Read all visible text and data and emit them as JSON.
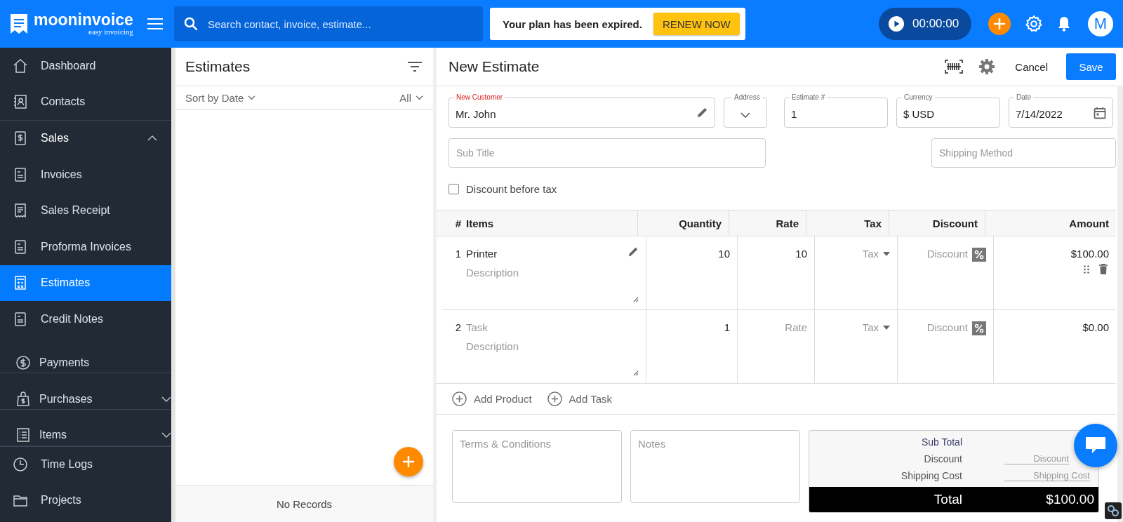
{
  "header": {
    "logo_name": "mooninvoice",
    "logo_tagline": "easy invoicing",
    "search": {
      "placeholder": "Search contact, invoice, estimate..."
    },
    "banner": {
      "message": "Your plan has been expired.",
      "button": "RENEW NOW"
    },
    "timer": "00:00:00",
    "avatar": "M"
  },
  "sidebar": {
    "items": [
      {
        "label": "Dashboard",
        "selected": false
      },
      {
        "label": "Contacts",
        "selected": false
      },
      {
        "label": "Sales",
        "selected": false,
        "expanded": true,
        "children": [
          {
            "label": "Invoices",
            "selected": false
          },
          {
            "label": "Sales Receipt",
            "selected": false
          },
          {
            "label": "Proforma Invoices",
            "selected": false
          },
          {
            "label": "Estimates",
            "selected": true
          },
          {
            "label": "Credit Notes",
            "selected": false
          },
          {
            "label": "Payments",
            "selected": false
          }
        ]
      },
      {
        "label": "Purchases",
        "selected": false,
        "expanded": false
      },
      {
        "label": "Items",
        "selected": false,
        "expanded": false
      },
      {
        "label": "Time Logs",
        "selected": false
      },
      {
        "label": "Projects",
        "selected": false
      }
    ]
  },
  "estimates_panel": {
    "title": "Estimates",
    "sort": "Sort by Date",
    "filter": "All",
    "empty_text": "No Records"
  },
  "editor": {
    "title": "New Estimate",
    "cancel": "Cancel",
    "save": "Save",
    "fields": [
      {
        "kind": "customer",
        "label": "New Customer",
        "value": "Mr. John",
        "required": true
      },
      {
        "kind": "select",
        "label": "Address",
        "required": false
      },
      {
        "kind": "text",
        "label": "Estimate #",
        "value": "1",
        "required": false
      },
      {
        "kind": "text",
        "label": "Currency",
        "value": "$ USD",
        "required": false
      },
      {
        "kind": "date",
        "label": "Date",
        "value": "7/14/2022",
        "required": false
      }
    ],
    "subtitle": {
      "placeholder": "Sub Title"
    },
    "shipping_method": {
      "placeholder": "Shipping Method"
    },
    "discount_before_tax": {
      "label": "Discount before tax",
      "checked": false
    },
    "table": {
      "columns": [
        "#",
        "Items",
        "Quantity",
        "Rate",
        "Tax",
        "Discount",
        "Amount"
      ],
      "rows": [
        {
          "kind": "product",
          "index": "1",
          "name": {
            "value": "Printer"
          },
          "description": {
            "placeholder": "Description"
          },
          "quantity": "10",
          "rate": {
            "value": "10"
          },
          "tax": {
            "placeholder": "Tax"
          },
          "discount": {
            "placeholder": "Discount"
          },
          "amount": "$100.00"
        },
        {
          "kind": "task",
          "index": "2",
          "name": {
            "placeholder": "Task"
          },
          "description": {
            "placeholder": "Description"
          },
          "quantity": "1",
          "rate": {
            "placeholder": "Rate"
          },
          "tax": {
            "placeholder": "Tax"
          },
          "discount": {
            "placeholder": "Discount"
          },
          "amount": "$0.00"
        }
      ]
    },
    "add_buttons": [
      "Add Product",
      "Add Task"
    ],
    "terms": {
      "placeholder": "Terms & Conditions"
    },
    "notes": {
      "placeholder": "Notes"
    },
    "totals": {
      "sub_total_label": "Sub Total",
      "discount_label": "Discount",
      "discount_placeholder": "Discount",
      "shipping_label": "Shipping Cost",
      "shipping_placeholder": "Shipping Cost",
      "total_label": "Total",
      "total_value": "$100.00"
    }
  }
}
